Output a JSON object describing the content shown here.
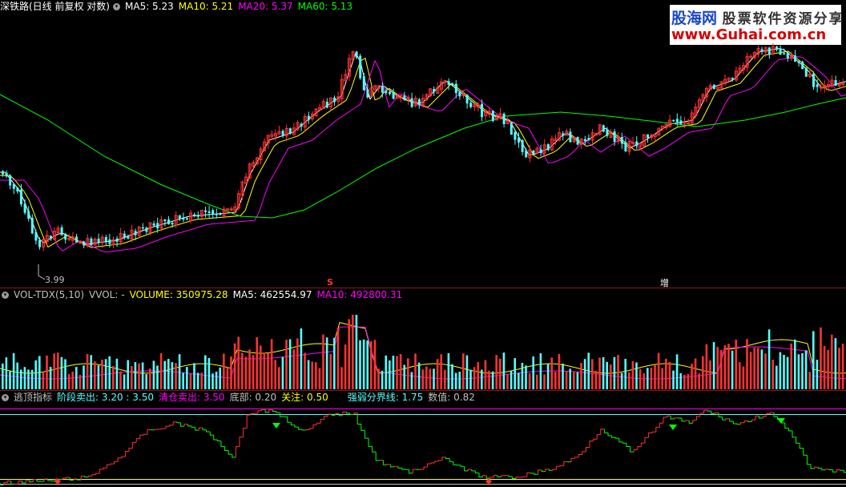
{
  "main_panel": {
    "title": "深铁路(日线 前复权 对数)",
    "ma5": "MA5: 5.23",
    "ma10": "MA10: 5.21",
    "ma20": "MA20: 5.37",
    "ma60": "MA60: 5.13",
    "low_label": "3.99",
    "marker_s": "S",
    "marker_zeng": "增"
  },
  "volume_panel": {
    "title": "VOL-TDX(5,10)",
    "vvol": "VVOL: -",
    "volume": "VOLUME: 350975.28",
    "ma5": "MA5: 462554.97",
    "ma10": "MA10: 492800.31"
  },
  "indicator_panel": {
    "title": "逃顶指标",
    "stage_sell": "阶段卖出: 3.20 : 3.50",
    "clear_sell": "清仓卖出: 3.50",
    "bottom": "底部: 0.20",
    "watch": "关注: 0.50",
    "divide_line": "强弱分界线: 1.75",
    "value": "数值: 0.82"
  },
  "watermark": {
    "brand": "股海网",
    "slogan": "股票软件资源分享",
    "url": "www.Guhai.com.cn"
  },
  "colors": {
    "up": "#ff3232",
    "down": "#54ffff",
    "ma5": "#ffffff",
    "ma10": "#ffff00",
    "ma20": "#ff00ff",
    "ma60": "#00ff00",
    "panel_border": "#8b1a1a"
  }
}
